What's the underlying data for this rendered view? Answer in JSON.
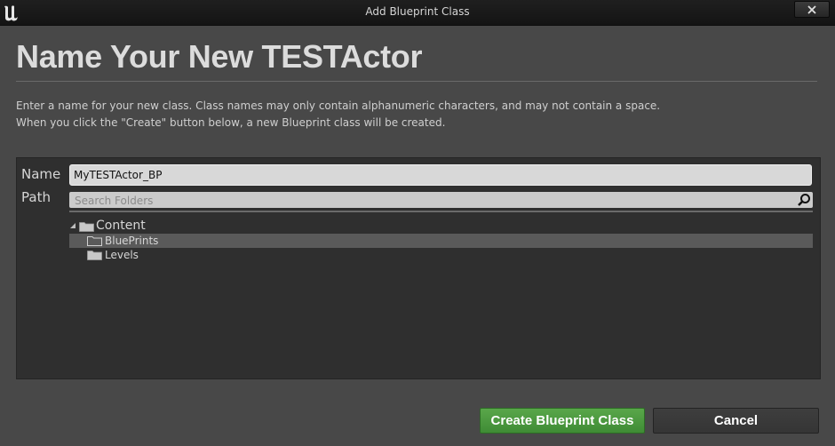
{
  "window": {
    "title": "Add Blueprint Class",
    "logo_icon": "unreal-logo-icon",
    "close_icon": "close-icon"
  },
  "header": {
    "title": "Name Your New TESTActor",
    "description_line1": "Enter a name for your new class. Class names may only contain alphanumeric characters, and may not contain a space.",
    "description_line2": "When you click the \"Create\" button below, a new Blueprint class will be created."
  },
  "form": {
    "name_label": "Name",
    "name_value": "MyTESTActor_BP",
    "path_label": "Path",
    "search_placeholder": "Search Folders",
    "search_icon": "search-icon"
  },
  "folder_tree": {
    "root": {
      "label": "Content",
      "expanded": true
    },
    "children": [
      {
        "label": "BluePrints",
        "selected": true
      },
      {
        "label": "Levels",
        "selected": false
      }
    ]
  },
  "actions": {
    "create_label": "Create Blueprint Class",
    "cancel_label": "Cancel"
  },
  "colors": {
    "background": "#484848",
    "panel": "#2f2f2f",
    "create_button": "#4a9a3e",
    "selected_row": "#5a5a5a"
  }
}
